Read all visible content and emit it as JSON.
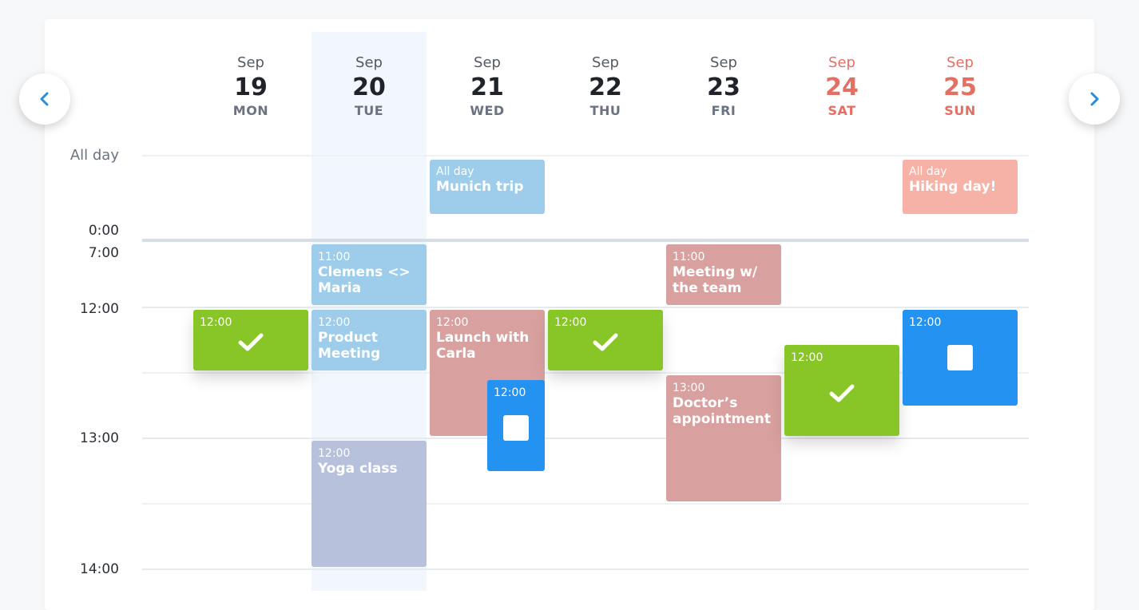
{
  "navigation": {
    "prev_icon": "chevron-left-icon",
    "next_icon": "chevron-right-icon"
  },
  "colors": {
    "accent": "#2492f0",
    "weekend": "#e46f63",
    "today_band": "#f2f7fd"
  },
  "days": [
    {
      "month": "Sep",
      "day": "19",
      "weekday": "MON",
      "weekend": false,
      "today": false
    },
    {
      "month": "Sep",
      "day": "20",
      "weekday": "TUE",
      "weekend": false,
      "today": true
    },
    {
      "month": "Sep",
      "day": "21",
      "weekday": "WED",
      "weekend": false,
      "today": false
    },
    {
      "month": "Sep",
      "day": "22",
      "weekday": "THU",
      "weekend": false,
      "today": false
    },
    {
      "month": "Sep",
      "day": "23",
      "weekday": "FRI",
      "weekend": false,
      "today": false
    },
    {
      "month": "Sep",
      "day": "24",
      "weekday": "SAT",
      "weekend": true,
      "today": false
    },
    {
      "month": "Sep",
      "day": "25",
      "weekday": "SUN",
      "weekend": true,
      "today": false
    }
  ],
  "time_labels": {
    "allday": "All day",
    "t0": "0:00",
    "t7": "7:00",
    "t12": "12:00",
    "t13": "13:00",
    "t14": "14:00"
  },
  "events": {
    "munich": {
      "time": "All day",
      "title": "Munich trip",
      "day": "Sep 21"
    },
    "hiking": {
      "time": "All day",
      "title": "Hiking day!",
      "day": "Sep 25"
    },
    "clemens": {
      "time": "11:00",
      "title": "Clemens <> Maria",
      "day": "Sep 20"
    },
    "meeting_team": {
      "time": "11:00",
      "title": "Meeting w/ the team",
      "day": "Sep 23"
    },
    "task_mon": {
      "time": "12:00",
      "status": "done",
      "day": "Sep 19"
    },
    "product": {
      "time": "12:00",
      "title": "Product Meeting",
      "day": "Sep 20"
    },
    "launch": {
      "time": "12:00",
      "title": "Launch with Carla",
      "day": "Sep 21"
    },
    "task_wed": {
      "time": "12:00",
      "status": "open",
      "day": "Sep 21"
    },
    "task_thu": {
      "time": "12:00",
      "status": "done",
      "day": "Sep 22"
    },
    "doctor": {
      "time": "13:00",
      "title": "Doctor’s appointment",
      "day": "Sep 23"
    },
    "task_sat": {
      "time": "12:00",
      "status": "done",
      "day": "Sep 24"
    },
    "task_sun": {
      "time": "12:00",
      "status": "open",
      "day": "Sep 25"
    },
    "yoga": {
      "time": "12:00",
      "title": "Yoga class",
      "day": "Sep 20"
    }
  }
}
